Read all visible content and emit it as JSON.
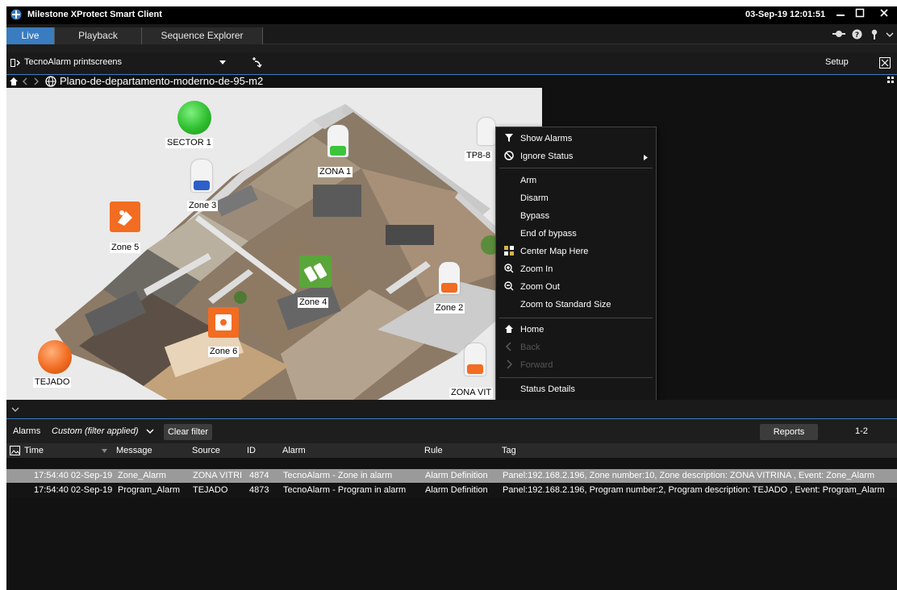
{
  "window": {
    "title": "Milestone XProtect Smart Client",
    "clock": "03-Sep-19 12:01:51"
  },
  "tabs": [
    {
      "label": "Live"
    },
    {
      "label": "Playback"
    },
    {
      "label": "Sequence Explorer"
    }
  ],
  "view": {
    "name": "TecnoAlarm printscreens",
    "setup_label": "Setup"
  },
  "map": {
    "breadcrumb": "Plano-de-departamento-moderno-de-95-m2",
    "labels": {
      "sector1": "SECTOR 1",
      "zona1": "ZONA 1",
      "zone3": "Zone 3",
      "zone5": "Zone 5",
      "zone4": "Zone 4",
      "zone2": "Zone 2",
      "zone6": "Zone 6",
      "tejado": "TEJADO",
      "tp8": "TP8-8",
      "zona_vitrina": "ZONA VIT"
    },
    "colors": {
      "green": "#3cc43c",
      "orange": "#f26c21",
      "zone4_green": "#5aa63a"
    }
  },
  "context_menu": {
    "items": [
      {
        "label": "Show Alarms",
        "icon": "funnel-icon"
      },
      {
        "label": "Ignore Status",
        "icon": "no-entry-icon"
      },
      {
        "label": "Arm"
      },
      {
        "label": "Disarm"
      },
      {
        "label": "Bypass"
      },
      {
        "label": "End of bypass"
      },
      {
        "label": "Center Map Here",
        "icon": "grid-icon"
      },
      {
        "label": "Zoom In",
        "icon": "zoom-in-icon"
      },
      {
        "label": "Zoom Out",
        "icon": "zoom-out-icon"
      },
      {
        "label": "Zoom to Standard Size"
      },
      {
        "label": "Home",
        "icon": "home-icon"
      },
      {
        "label": "Back",
        "icon": "back-icon"
      },
      {
        "label": "Forward",
        "icon": "forward-icon"
      },
      {
        "label": "Status Details"
      }
    ]
  },
  "alarms": {
    "label": "Alarms",
    "filter": "Custom (filter applied)",
    "clear_filter": "Clear filter",
    "reports": "Reports",
    "range": "1-2",
    "columns": [
      "Time",
      "Message",
      "Source",
      "ID",
      "Alarm",
      "Rule",
      "Tag"
    ],
    "rows": [
      {
        "time": "17:54:40 02-Sep-19",
        "message": "Zone_Alarm",
        "source": "ZONA VITRI",
        "id": "4874",
        "alarm": "TecnoAlarm - Zone in alarm",
        "rule": "Alarm Definition",
        "tag": "Panel:192.168.2.196, Zone number:10, Zone description: ZONA VITRINA , Event: Zone_Alarm"
      },
      {
        "time": "17:54:40 02-Sep-19",
        "message": "Program_Alarm",
        "source": "TEJADO",
        "id": "4873",
        "alarm": "TecnoAlarm - Program in alarm",
        "rule": "Alarm Definition",
        "tag": "Panel:192.168.2.196, Program number:2, Program description: TEJADO , Event: Program_Alarm"
      }
    ]
  }
}
